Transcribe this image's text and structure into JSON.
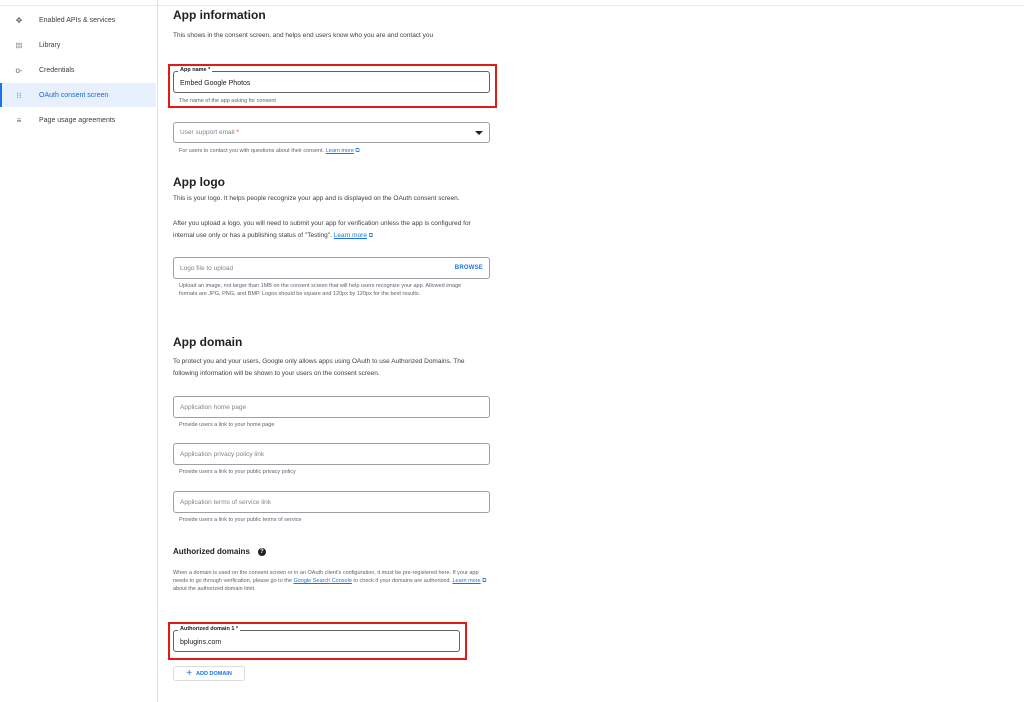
{
  "sidebar": {
    "items": [
      {
        "icon": "api-icon",
        "glyph": "✥",
        "label": "Enabled APIs & services",
        "active": false
      },
      {
        "icon": "library-icon",
        "glyph": "𝍖",
        "label": "Library",
        "active": false
      },
      {
        "icon": "key-icon",
        "glyph": "o-",
        "label": "Credentials",
        "active": false
      },
      {
        "icon": "consent-icon",
        "glyph": "⁝⁝",
        "label": "OAuth consent screen",
        "active": true
      },
      {
        "icon": "settings-list-icon",
        "glyph": "≡",
        "label": "Page usage agreements",
        "active": false
      }
    ]
  },
  "app_info": {
    "title": "App information",
    "description": "This shows in the consent screen, and helps end users know who you are and contact you",
    "app_name_label": "App name *",
    "app_name_value": "Embed Google Photos",
    "app_name_hint": "The name of the app asking for consent",
    "support_email_placeholder": "User support email",
    "support_email_required": "*",
    "support_email_hint": "For users to contact you with questions about their consent.",
    "learn_more": "Learn more"
  },
  "app_logo": {
    "title": "App logo",
    "description_1": "This is your logo. It helps people recognize your app and is displayed on the OAuth consent screen.",
    "description_2": "After you upload a logo, you will need to submit your app for verification unless the app is configured for internal use only or has a publishing status of \"Testing\".",
    "learn_more": "Learn more",
    "upload_placeholder": "Logo file to upload",
    "browse_label": "BROWSE",
    "upload_hint": "Upload an image, not larger than 1MB on the consent screen that will help users recognize your app. Allowed image formats are JPG, PNG, and BMP. Logos should be square and 120px by 120px for the best results."
  },
  "app_domain": {
    "title": "App domain",
    "description": "To protect you and your users, Google only allows apps using OAuth to use Authorized Domains. The following information will be shown to your users on the consent screen.",
    "home_page_placeholder": "Application home page",
    "home_page_hint": "Provide users a link to your home page",
    "privacy_placeholder": "Application privacy policy link",
    "privacy_hint": "Provide users a link to your public privacy policy",
    "terms_placeholder": "Application terms of service link",
    "terms_hint": "Provide users a link to your public terms of service"
  },
  "authorized_domains": {
    "title": "Authorized domains",
    "help_glyph": "?",
    "description_1": "When a domain is used on the consent screen or in an OAuth client's configuration, it must be pre-registered here. If your app needs to go through verification, please go to the",
    "search_console_link": "Google Search Console",
    "description_2": "to check if your domains are authorized.",
    "learn_more": "Learn more",
    "description_3": "about the authorized domain limit.",
    "domain_label": "Authorized domain 1 *",
    "domain_value": "bplugins.com",
    "add_button": "ADD DOMAIN",
    "add_glyph": "+"
  },
  "colors": {
    "accent": "#1a73e8",
    "highlight": "#e01b1b",
    "active_bg": "#e8f0fe"
  }
}
